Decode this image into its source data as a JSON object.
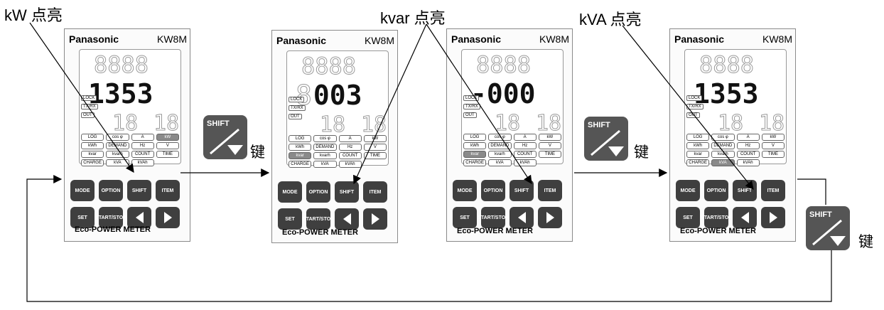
{
  "captions": {
    "kw": "kW 点亮",
    "kvar": "kvar 点亮",
    "kva": "kVA 点亮"
  },
  "key_label": "键",
  "meter": {
    "brand": "Panasonic",
    "model": "KW8M",
    "status_labels": [
      "LOCK",
      "TX/RX",
      "OUT"
    ],
    "unit_labels": [
      "LOG",
      "cos φ",
      "A",
      "kW",
      "kWh",
      "DEMAND",
      "Hz",
      "V",
      "kvar",
      "kvarh",
      "COUNT",
      "TIME",
      "CHARGE",
      "kVA",
      "kVAh"
    ],
    "buttons": {
      "mode": "MODE",
      "option": "OPTION",
      "shift": "SHIFT",
      "item": "ITEM",
      "set": "SET",
      "start_stop": "START/STOP"
    },
    "footer": "Eco-POWER METER"
  },
  "panels": [
    {
      "reading": "1353",
      "lit_unit": "kW"
    },
    {
      "reading": "003",
      "lit_unit": "kvar"
    },
    {
      "reading": "-000",
      "lit_unit": "kvar"
    },
    {
      "reading": "1353",
      "lit_unit": "kVA"
    }
  ],
  "shift_key": {
    "label": "SHIFT",
    "icon": "slash-down-triangle-icon"
  }
}
